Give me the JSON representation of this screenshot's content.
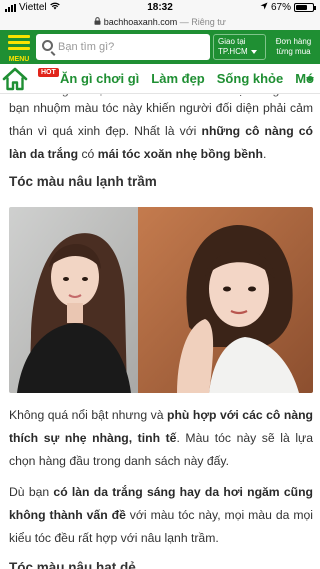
{
  "status_bar": {
    "carrier": "Viettel",
    "time": "18:32",
    "battery": "67%",
    "battery_level": 0.67
  },
  "url_bar": {
    "domain": "bachhoaxanh.com",
    "suffix": "— Riêng tư"
  },
  "header": {
    "menu_label": "MENU",
    "search_placeholder": "Bạn tìm gì?",
    "location_line1": "Giao tại",
    "location_line2": "TP.HCM",
    "orders_line1": "Đơn hàng",
    "orders_line2": "từng mua",
    "colors": {
      "brand_green": "#1f8f33",
      "menu_yellow": "#fbe300"
    }
  },
  "category_bar": {
    "hot_badge": "HOT",
    "items": [
      "Ăn gì chơi gì",
      "Làm đẹp",
      "Sống khỏe",
      "Mó"
    ]
  },
  "article": {
    "cut_line": "chính là người bạn của nét vẽ kiểu cá và dịu dàng khi",
    "p1": {
      "t1": "bạn nhuộm màu tóc này khiến người đối diện phải cảm thán vì quá xinh đẹp. Nhất là với ",
      "b1": "những cô nàng có làn da trắng",
      "t2": " có ",
      "b2": "mái tóc xoăn nhẹ bồng bềnh",
      "t3": "."
    },
    "heading_1": "Tóc màu nâu lạnh trầm",
    "p2": {
      "t1": "Không quá nổi bật nhưng và ",
      "b1": "phù hợp với các cô nàng thích sự nhẹ nhàng, tinh tế",
      "t2": ". Màu tóc này sẽ là lựa chọn hàng đầu trong danh sách này đấy."
    },
    "p3": {
      "t1": "Dù bạn ",
      "b1": "có làn da trắng sáng hay da hơi ngăm cũng không thành vấn đề",
      "t2": " với màu tóc này, mọi màu da mọi kiểu tóc đều rất hợp với nâu lạnh trầm."
    },
    "heading_2": "Tóc màu nâu hạt dẻ"
  }
}
